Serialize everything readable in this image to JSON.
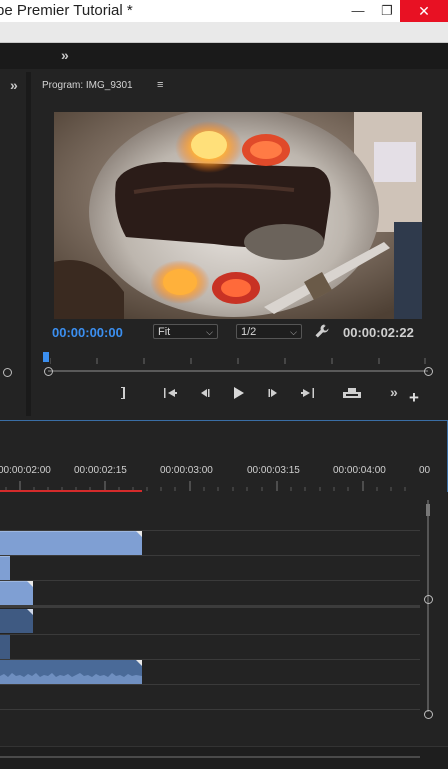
{
  "window": {
    "title": "be Premier Tutorial *",
    "minimize": "—",
    "restore": "❐",
    "close": "✕"
  },
  "workspace": {
    "overflow_chevron": "»"
  },
  "left_panel": {
    "overflow_chevron": "»"
  },
  "program_monitor": {
    "title": "Program: IMG_9301",
    "menu_icon": "≡",
    "current_timecode": "00:00:00:00",
    "duration_timecode": "00:00:02:22",
    "zoom_select": "Fit",
    "resolution_select": "1/2",
    "settings_icon": "wrench-icon",
    "controls": [
      "mark-in",
      "go-to-in",
      "step-back",
      "play",
      "step-forward",
      "go-to-out",
      "export-frame"
    ],
    "overflow_chevron": "»",
    "add_button": "+"
  },
  "timeline": {
    "ruler_labels": [
      "00:00:02:00",
      "00:00:02:15",
      "00:00:03:00",
      "00:00:03:15",
      "00:00:04:00",
      "00"
    ]
  },
  "colors": {
    "accent_timecode": "#3b8ff0",
    "playhead_range": "#d42b2b",
    "video_clip": "#7f9fd3",
    "audio_clip": "#3f5a82",
    "close_button": "#e81123"
  }
}
